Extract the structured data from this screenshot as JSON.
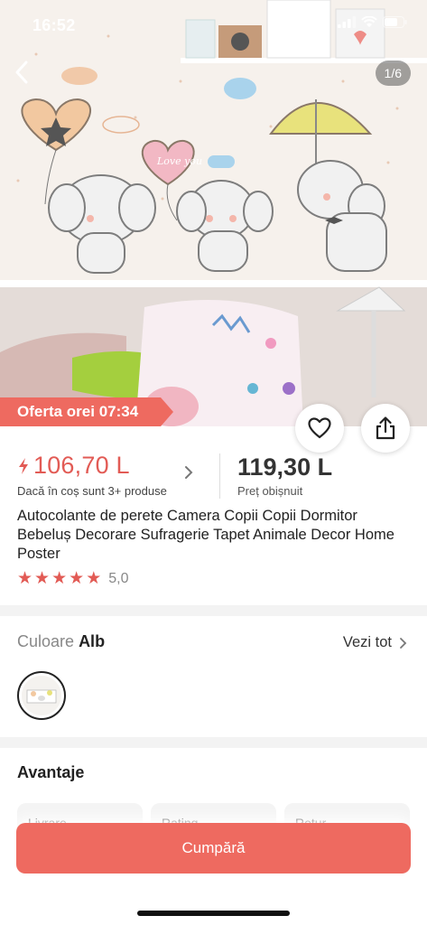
{
  "status_bar": {
    "time": "16:52"
  },
  "gallery": {
    "counter": "1/6",
    "offer_banner": "Oferta orei 07:34"
  },
  "heart_balloon_text": "Love you",
  "price": {
    "promo_amount": "106,70 L",
    "promo_note": "Dacă în coș sunt 3+ produse",
    "regular_amount": "119,30 L",
    "regular_note": "Preț obișnuit",
    "accent_color": "#e25b55"
  },
  "product": {
    "title": "Autocolante de perete Camera Copii Copii Dormitor Bebeluș Decorare Sufragerie Tapet Animale Decor Home Poster",
    "rating": {
      "stars": 5,
      "score": "5,0"
    }
  },
  "color": {
    "label": "Culoare",
    "value": "Alb",
    "see_all": "Vezi tot"
  },
  "advantages": {
    "title": "Avantaje",
    "cards": [
      {
        "label": "Livrare"
      },
      {
        "label": "Rating"
      },
      {
        "label": "Retur"
      }
    ]
  },
  "buy_button": {
    "label": "Cumpără",
    "color": "#ee6a60"
  },
  "icons": [
    "back-arrow-icon",
    "heart-icon",
    "share-icon",
    "lightning-icon",
    "chevron-right-icon",
    "star-icon",
    "signal-icon",
    "wifi-icon",
    "battery-icon"
  ]
}
